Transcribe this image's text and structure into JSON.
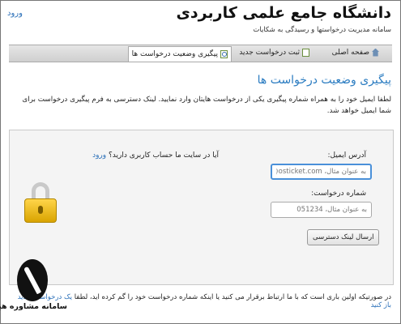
{
  "header": {
    "login_link": "ورود",
    "site_title": "دانشگاه جامع علمی کاربردی",
    "site_subtitle": "سامانه مدیریت درخواستها و رسیدگی به شکایات"
  },
  "nav": {
    "items": [
      {
        "label": "صفحه اصلی",
        "icon": "home-icon"
      },
      {
        "label": "ثبت درخواست جدید",
        "icon": "new-ticket-icon"
      },
      {
        "label": "پیگیری وضعیت درخواست ها",
        "icon": "ticket-status-icon",
        "active": true
      }
    ]
  },
  "main": {
    "title": "پیگیری وضعیت درخواست ها",
    "intro": "لطفا ایمیل خود را به همراه شماره پیگیری یکی از درخواست هایتان وارد نمایید. لینک دسترسی به فرم پیگیری درخواست برای شما ایمیل خواهد شد."
  },
  "form": {
    "email_label": "آدرس ایمیل:",
    "email_placeholder": "به عنوان مثال، john.doe@osticket.com",
    "ticket_label": "شماره درخواست:",
    "ticket_placeholder": "به عنوان مثال، 051234",
    "submit_label": "ارسال لینک دسترسی",
    "account_question": "آیا در سایت ما حساب کاربری دارید؟",
    "account_login_link": "ورود"
  },
  "footer": {
    "text": "در صورتیکه اولین باری است که با ما ارتباط برقرار می کنید یا اینکه شماره درخواست خود را گم کرده اید، لطفا",
    "link": "یک درخواست جدید باز کنید"
  },
  "watermark": {
    "text": "سامانه مشاوره هیوا"
  }
}
